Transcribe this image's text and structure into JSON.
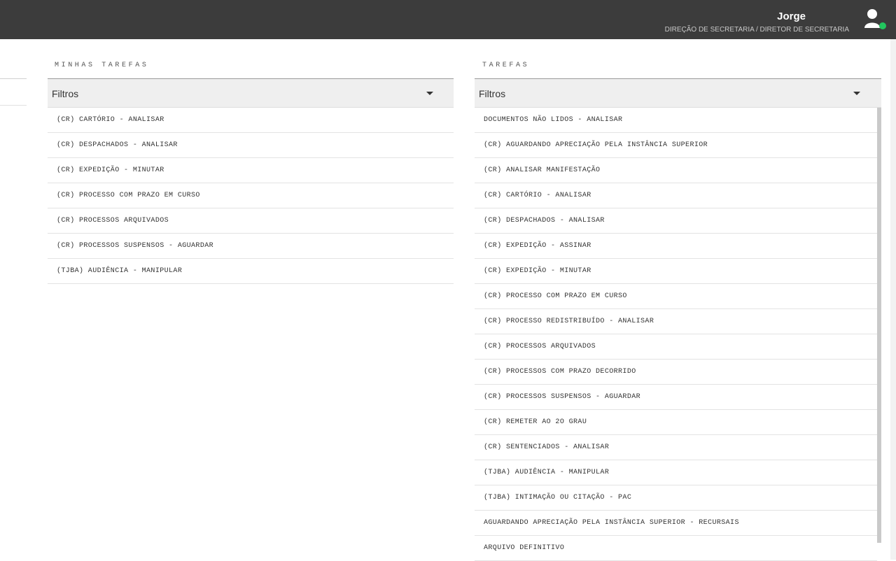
{
  "header": {
    "user_name": "Jorge",
    "user_role": "DIREÇÃO DE SECRETARIA / DIRETOR DE SECRETARIA",
    "status_color": "#22c55e"
  },
  "my_tasks": {
    "title": "MINHAS TAREFAS",
    "filter_label": "Filtros",
    "items": [
      "(CR) CARTÓRIO - ANALISAR",
      "(CR) DESPACHADOS - ANALISAR",
      "(CR) EXPEDIÇÃO - MINUTAR",
      "(CR) PROCESSO COM PRAZO EM CURSO",
      "(CR) PROCESSOS ARQUIVADOS",
      "(CR) PROCESSOS SUSPENSOS - AGUARDAR",
      "(TJBA) AUDIÊNCIA - MANIPULAR"
    ]
  },
  "tasks": {
    "title": "TAREFAS",
    "filter_label": "Filtros",
    "items": [
      "DOCUMENTOS NÃO LIDOS - ANALISAR",
      "(CR) AGUARDANDO APRECIAÇÃO PELA INSTÂNCIA SUPERIOR",
      "(CR) ANALISAR MANIFESTAÇÃO",
      "(CR) CARTÓRIO - ANALISAR",
      "(CR) DESPACHADOS - ANALISAR",
      "(CR) EXPEDIÇÃO - ASSINAR",
      "(CR) EXPEDIÇÃO - MINUTAR",
      "(CR) PROCESSO COM PRAZO EM CURSO",
      "(CR) PROCESSO REDISTRIBUÍDO - ANALISAR",
      "(CR) PROCESSOS ARQUIVADOS",
      "(CR) PROCESSOS COM PRAZO DECORRIDO",
      "(CR) PROCESSOS SUSPENSOS - AGUARDAR",
      "(CR) REMETER AO 2O GRAU",
      "(CR) SENTENCIADOS - ANALISAR",
      "(TJBA) AUDIÊNCIA - MANIPULAR",
      "(TJBA) INTIMAÇÃO OU CITAÇÃO - PAC",
      "AGUARDANDO APRECIAÇÃO PELA INSTÂNCIA SUPERIOR - RECURSAIS",
      "ARQUIVO DEFINITIVO"
    ]
  }
}
